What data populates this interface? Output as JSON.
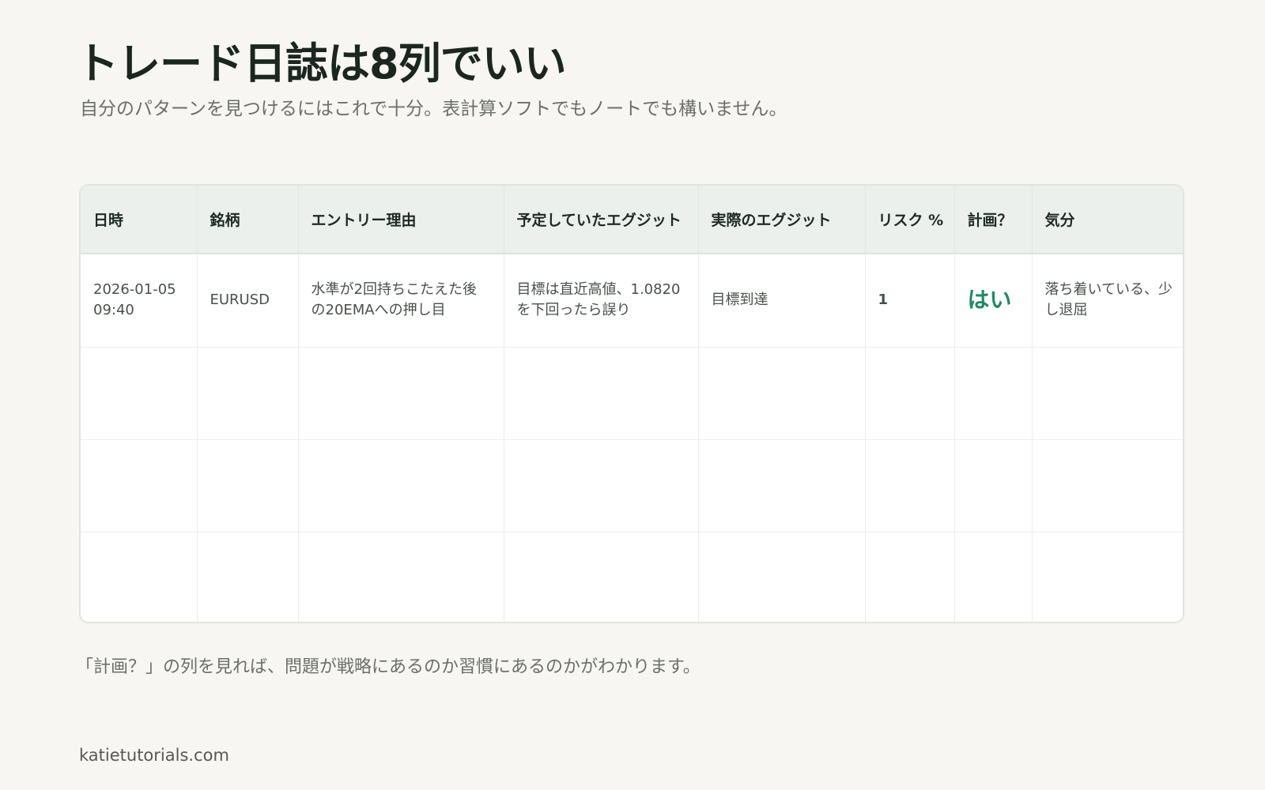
{
  "header": {
    "title": "トレード日誌は8列でいい",
    "subtitle": "自分のパターンを見つけるにはこれで十分。表計算ソフトでもノートでも構いません。"
  },
  "table": {
    "columns": [
      "日時",
      "銘柄",
      "エントリー理由",
      "予定していたエグジット",
      "実際のエグジット",
      "リスク %",
      "計画？",
      "気分"
    ],
    "rows": [
      {
        "datetime": "2026-01-05 09:40",
        "symbol": "EURUSD",
        "entry_reason": "水準が2回持ちこたえた後の20EMAへの押し目",
        "planned_exit": "目標は直近高値、1.0820を下回ったら誤り",
        "actual_exit": "目標到達",
        "risk_pct": "1",
        "plan": "はい",
        "mood": "落ち着いている、少し退屈"
      }
    ],
    "empty_rows": 3
  },
  "footer": {
    "note": "「計画？」の列を見れば、問題が戦略にあるのか習慣にあるのかがわかります。",
    "site": "katietutorials.com"
  },
  "colors": {
    "background": "#f7f6f2",
    "header_row": "#ebf0ec",
    "accent_green": "#1e8a67",
    "title": "#1b2620"
  }
}
